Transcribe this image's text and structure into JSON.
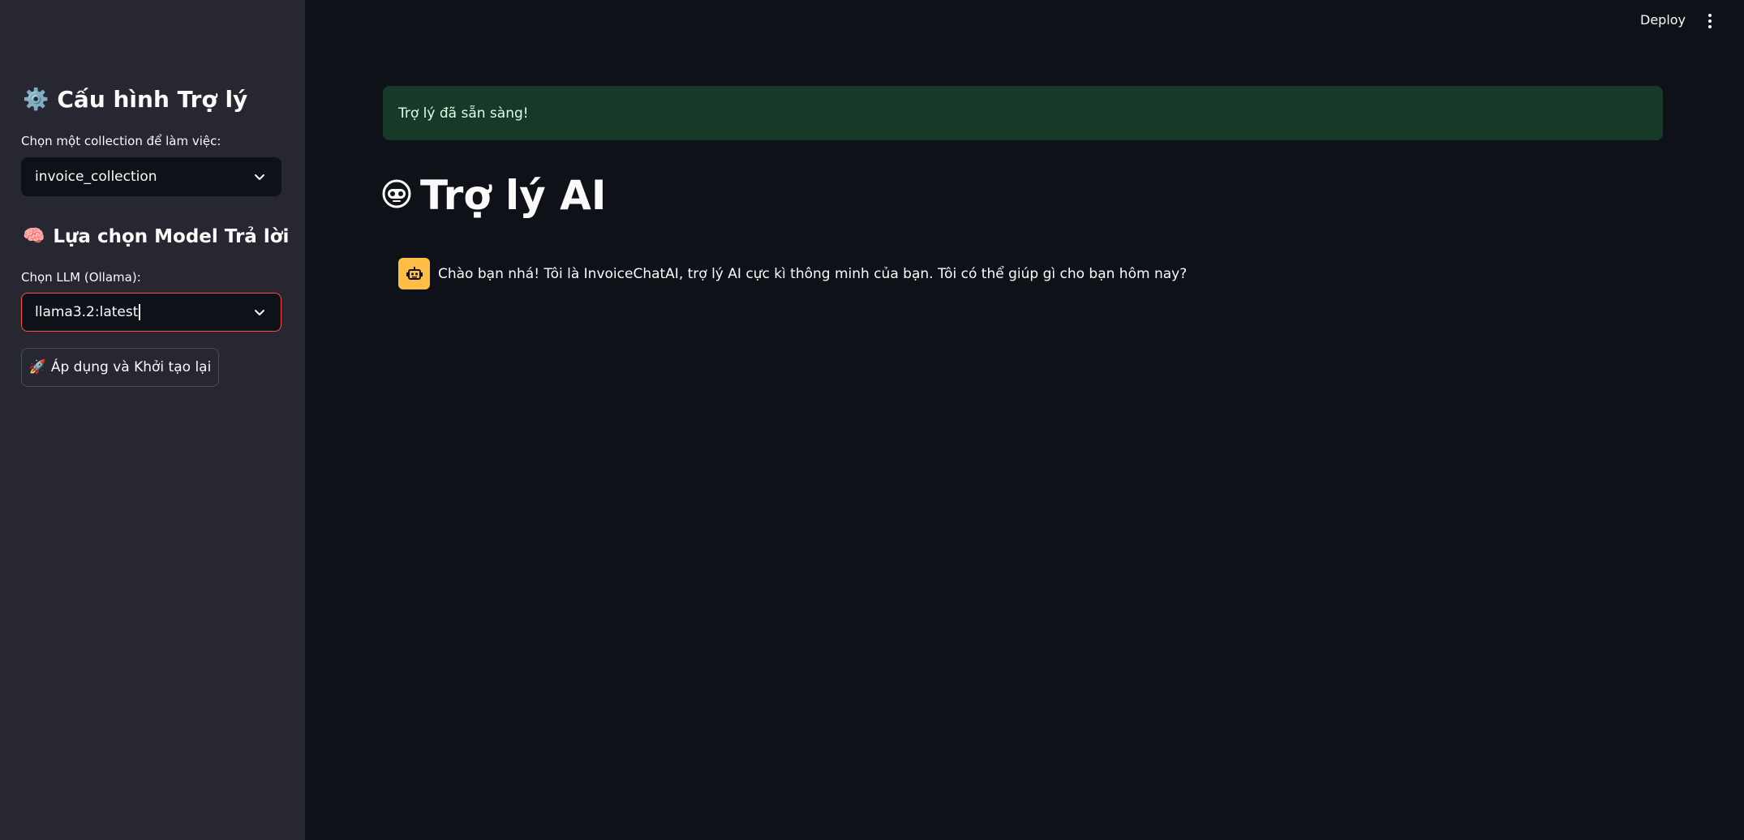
{
  "sidebar": {
    "config_heading": "Cấu hình Trợ lý",
    "config_icon": "gear-icon",
    "collection_label": "Chọn một collection để làm việc:",
    "collection_value": "invoice_collection",
    "model_heading": "Lựa chọn Model Trả lời",
    "model_icon": "brain-icon",
    "llm_label": "Chọn LLM (Ollama):",
    "llm_value": "llama3.2:latest",
    "apply_button_label": "Áp dụng và Khởi tạo lại",
    "apply_button_icon": "rocket-icon"
  },
  "header": {
    "deploy_label": "Deploy",
    "menu_icon": "more-vertical-icon"
  },
  "main": {
    "alert_text": "Trợ lý đã sẵn sàng!",
    "title": "Trợ lý AI",
    "title_icon": "robot-face-icon",
    "messages": [
      {
        "role": "assistant",
        "avatar_icon": "robot-icon",
        "text": "Chào bạn nhá! Tôi là InvoiceChatAI, trợ lý AI cực kì thông minh của bạn. Tôi có thể giúp gì cho bạn hôm nay?"
      }
    ]
  },
  "colors": {
    "background": "#0e1117",
    "sidebar": "#262730",
    "alert_bg": "#173928",
    "focus_border": "#ff4b4b",
    "avatar_bg": "#ffbd45"
  }
}
